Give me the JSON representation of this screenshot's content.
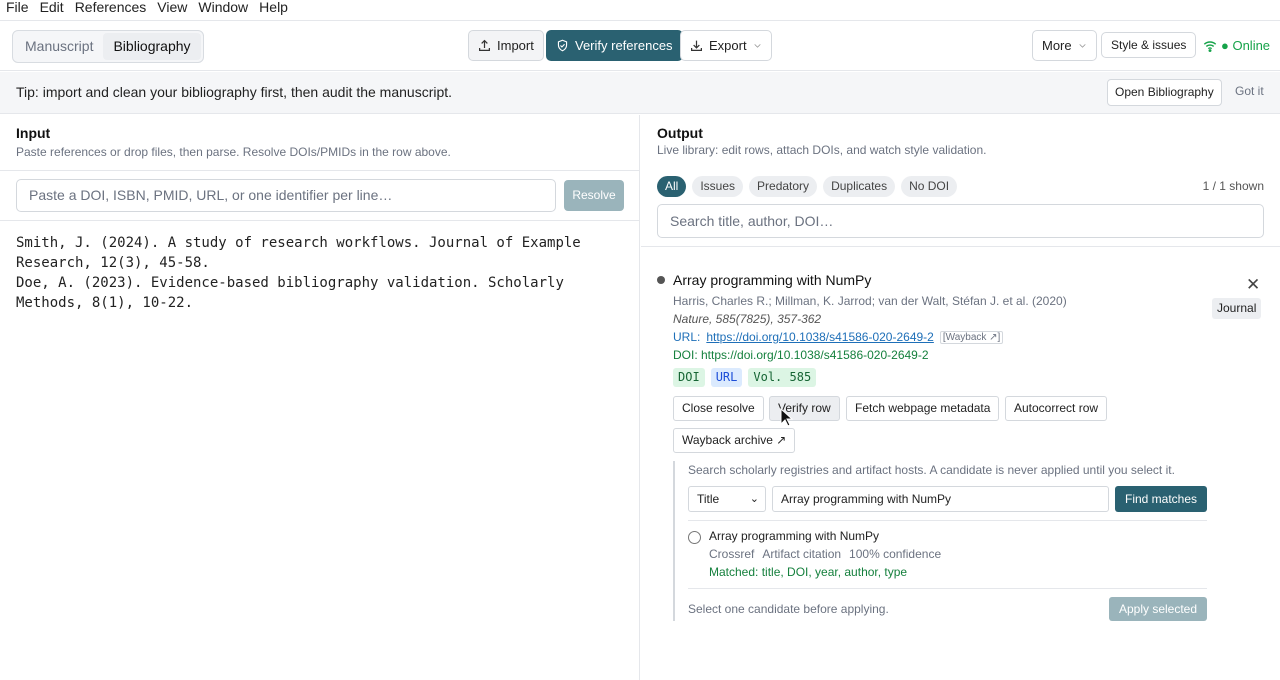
{
  "menu": [
    "File",
    "Edit",
    "References",
    "View",
    "Window",
    "Help"
  ],
  "toolbar": {
    "tabs": [
      "Manuscript",
      "Bibliography"
    ],
    "active_tab": "Bibliography",
    "import_label": "Import",
    "verify_label": "Verify references",
    "export_label": "Export",
    "more_label": "More",
    "style_label": "Style & issues",
    "status": "● Online"
  },
  "tip": {
    "text": "Tip: import and clean your bibliography first, then audit the manuscript.",
    "open_label": "Open Bibliography",
    "dismiss_label": "Got it"
  },
  "input": {
    "title": "Input",
    "subtitle": "Paste references or drop files, then parse. Resolve DOIs/PMIDs in the row above.",
    "placeholder": "Paste a DOI, ISBN, PMID, URL, or one identifier per line…",
    "resolve_label": "Resolve",
    "raw_text": "Smith, J. (2024). A study of research workflows. Journal of Example Research, 12(3), 45-58.\nDoe, A. (2023). Evidence-based bibliography validation. Scholarly Methods, 8(1), 10-22."
  },
  "output": {
    "title": "Output",
    "subtitle": "Live library: edit rows, attach DOIs, and watch style validation.",
    "filters": [
      "All",
      "Issues",
      "Predatory",
      "Duplicates",
      "No DOI"
    ],
    "active_filter": "All",
    "count": "1 / 1 shown",
    "search_placeholder": "Search title, author, DOI…"
  },
  "record": {
    "title": "Array programming with NumPy",
    "authors": "Harris, Charles R.; Millman, K. Jarrod; van der Walt, Stéfan J. et al. (2020)",
    "journal": "Nature, 585(7825), 357-362",
    "url_label": "URL:",
    "url": "https://doi.org/10.1038/s41586-020-2649-2",
    "wayback_link": "[Wayback ↗]",
    "doi_line": "DOI: https://doi.org/10.1038/s41586-020-2649-2",
    "tags": [
      "DOI",
      "URL",
      "Vol. 585"
    ],
    "type": "Journal",
    "actions": [
      "Close resolve",
      "Verify row",
      "Fetch webpage metadata",
      "Autocorrect row",
      "Wayback archive ↗"
    ]
  },
  "resolve_panel": {
    "description": "Search scholarly registries and artifact hosts. A candidate is never applied until you select it.",
    "field": "Title",
    "query": "Array programming with NumPy",
    "find_label": "Find matches",
    "candidate": {
      "title": "Array programming with NumPy",
      "source": "Crossref",
      "kind": "Artifact citation",
      "confidence": "100% confidence",
      "matched": "Matched: title, DOI, year, author, type"
    },
    "hint": "Select one candidate before applying.",
    "apply_label": "Apply selected"
  },
  "colors": {
    "accent": "#2a6171",
    "success": "#16a34a",
    "link": "#1e6fb8"
  }
}
